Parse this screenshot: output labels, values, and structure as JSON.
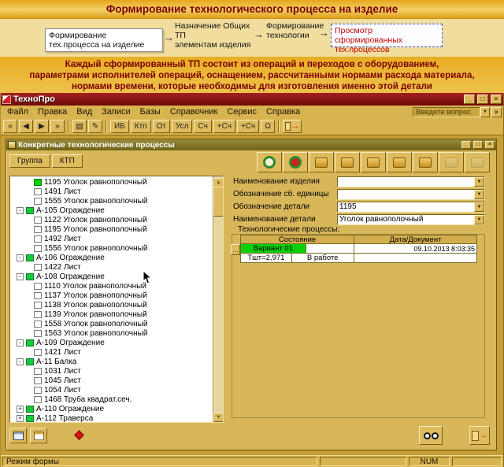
{
  "banner": {
    "title": "Формирование технологического процесса на изделие"
  },
  "flow": {
    "box_left": "Формирование\nтех.процесса на изделие",
    "step_assign": "Назначение Общих ТП\nэлементам изделия",
    "step_form": "Формирование\nтехнологии",
    "box_right": "Просмотр сформированных\nтех.процессов",
    "arrow": "→"
  },
  "description": [
    "Каждый сформированный ТП состоит из операций и переходов с оборудованием,",
    "параметрами исполнителей операций, оснащением, рассчитанными нормами расхода материала,",
    "нормами времени, которые необходимы для изготовления именно этой детали"
  ],
  "window": {
    "title": "ТехноПро",
    "controls": {
      "minimize": "_",
      "maximize": "□",
      "close": "×"
    },
    "menu": [
      "Файл",
      "Правка",
      "Вид",
      "Записи",
      "Базы",
      "Справочник",
      "Сервис",
      "Справка"
    ],
    "question_box": "Введите вопрос",
    "toolbar": {
      "nav": [
        "«",
        "◀",
        "▶",
        "»"
      ],
      "icons": [
        {
          "name": "list-icon",
          "glyph": "▤"
        },
        {
          "name": "edit-icon",
          "glyph": "✎"
        }
      ],
      "text_buttons": [
        "ИБ",
        "Ктп",
        "От",
        "Усл",
        "Сч",
        "+Сч",
        "+Сч",
        "Ω"
      ],
      "exit_glyph": "→"
    }
  },
  "inner_window": {
    "title": "Конкретные технологические процессы",
    "controls": {
      "minimize": "_",
      "maximize": "□",
      "close": "×"
    },
    "tabs": [
      "Группа",
      "КТП"
    ],
    "icon_buttons": [
      {
        "name": "variants-laurel-icon",
        "style": "laurel"
      },
      {
        "name": "approve-laurel-icon",
        "style": "laurel2"
      },
      {
        "name": "sketch-icon",
        "style": "gold"
      },
      {
        "name": "operations-icon",
        "style": "gold"
      },
      {
        "name": "equipment-icon",
        "style": "gold"
      },
      {
        "name": "tooling-icon",
        "style": "gold"
      },
      {
        "name": "materials-icon",
        "style": "gold"
      },
      {
        "name": "norms-icon",
        "style": "dim"
      },
      {
        "name": "documents-icon",
        "style": "dim"
      }
    ],
    "tree": [
      {
        "label": "1195 Уголок равнополочный",
        "type": "leaf",
        "selected": true
      },
      {
        "label": "1491 Лист",
        "type": "leaf"
      },
      {
        "label": "1555 Уголок равнополочный",
        "type": "leaf"
      },
      {
        "label": "А-105 Ограждение",
        "type": "group"
      },
      {
        "label": "1122 Уголок равнополочный",
        "type": "leaf"
      },
      {
        "label": "1195 Уголок равнополочный",
        "type": "leaf"
      },
      {
        "label": "1492 Лист",
        "type": "leaf"
      },
      {
        "label": "1556 Уголок равнополочный",
        "type": "leaf"
      },
      {
        "label": "А-106 Ограждение",
        "type": "group"
      },
      {
        "label": "1422 Лист",
        "type": "leaf"
      },
      {
        "label": "А-108 Ограждение",
        "type": "group"
      },
      {
        "label": "1110 Уголок равнополочный",
        "type": "leaf"
      },
      {
        "label": "1137 Уголок равнополочный",
        "type": "leaf"
      },
      {
        "label": "1138 Уголок равнополочный",
        "type": "leaf"
      },
      {
        "label": "1139 Уголок равнополочный",
        "type": "leaf"
      },
      {
        "label": "1558 Уголок равнополочный",
        "type": "leaf"
      },
      {
        "label": "1563 Уголок равнополочный",
        "type": "leaf"
      },
      {
        "label": "А-109 Ограждение",
        "type": "group"
      },
      {
        "label": "1421 Лист",
        "type": "leaf"
      },
      {
        "label": "А-11 Балка",
        "type": "group"
      },
      {
        "label": "1031 Лист",
        "type": "leaf"
      },
      {
        "label": "1045 Лист",
        "type": "leaf"
      },
      {
        "label": "1054 Лист",
        "type": "leaf"
      },
      {
        "label": "1468 Труба квадрат.сеч.",
        "type": "leaf"
      },
      {
        "label": "А-110 Ограждение",
        "type": "group",
        "collapsed": true
      },
      {
        "label": "А-112 Траверса",
        "type": "group",
        "collapsed": true
      }
    ],
    "form": {
      "fields": [
        {
          "label": "Наименование изделия",
          "value": ""
        },
        {
          "label": "Обозначение сб. единицы",
          "value": ""
        },
        {
          "label": "Обозначение детали",
          "value": "1195"
        },
        {
          "label": "Наименование детали",
          "value": "Уголок равнополочный"
        }
      ],
      "processes_label": "Технологические процессы:",
      "table": {
        "headers": [
          "Состояние",
          "Дата/Документ"
        ],
        "selector": "…",
        "variant": "Вариант 01",
        "date": "09.10.2013 8:03:35",
        "tsht": "Тшт=2,971",
        "status": "В работе"
      }
    }
  },
  "statusbar": {
    "mode": "Режим формы",
    "num": "NUM"
  },
  "scroll": {
    "up": "▲",
    "down": "▼"
  }
}
